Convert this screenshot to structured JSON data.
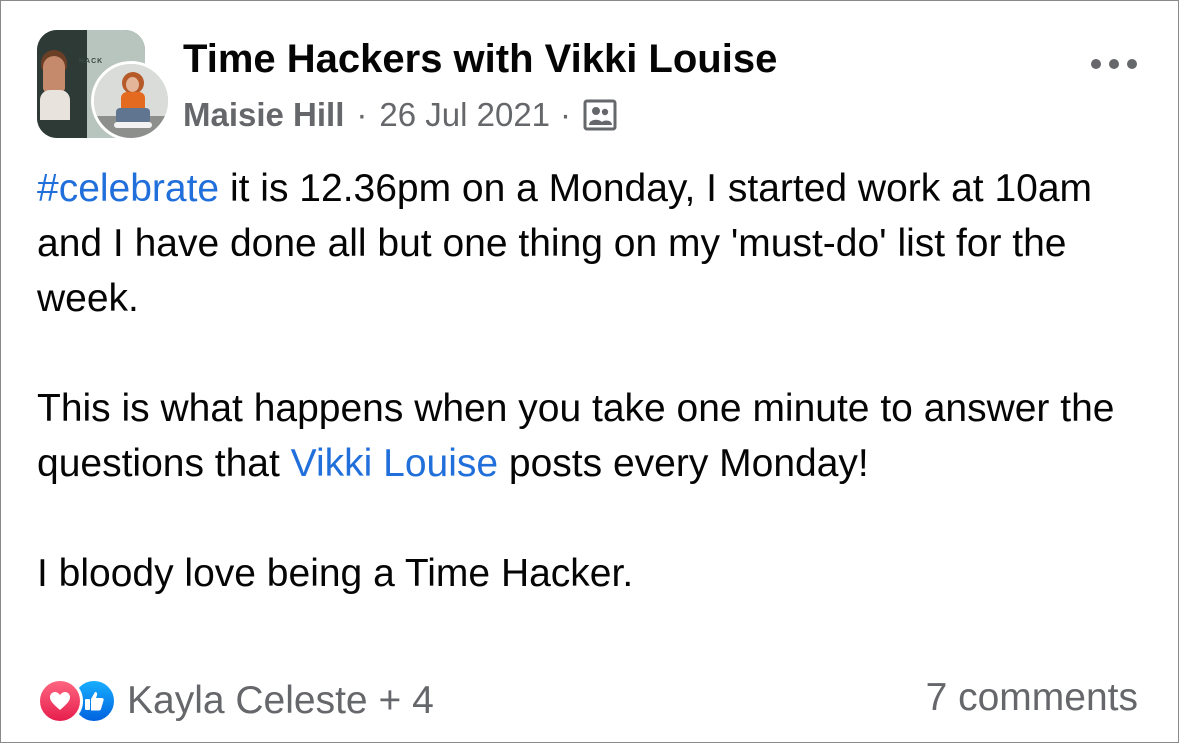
{
  "header": {
    "group_name": "Time Hackers with Vikki Louise",
    "group_thumb_text": "HACK",
    "author": "Maisie Hill",
    "separator": "·",
    "date": "26 Jul 2021",
    "audience_icon": "group-audience-icon",
    "more_icon": "more-horizontal-icon"
  },
  "post": {
    "paragraph1": {
      "hashtag": "#celebrate",
      "text_after_hashtag": " it is 12.36pm on a Monday, I started work at 10am and I have done all but one thing on my 'must-do' list for the week."
    },
    "paragraph2": {
      "text_before_mention": "This is what happens when you take one minute to answer the questions that ",
      "mention": "Vikki Louise",
      "text_after_mention": " posts every Monday!"
    },
    "paragraph3": {
      "text": "I bloody love being a Time Hacker."
    }
  },
  "footer": {
    "reaction_icons": [
      "love-icon",
      "like-icon"
    ],
    "reaction_summary": "Kayla Celeste + 4",
    "comments": "7 comments"
  },
  "colors": {
    "link": "#216fdb",
    "secondary_text": "#65676b",
    "primary_text": "#050505",
    "love": "#f33e58",
    "like": "#1877f2"
  }
}
